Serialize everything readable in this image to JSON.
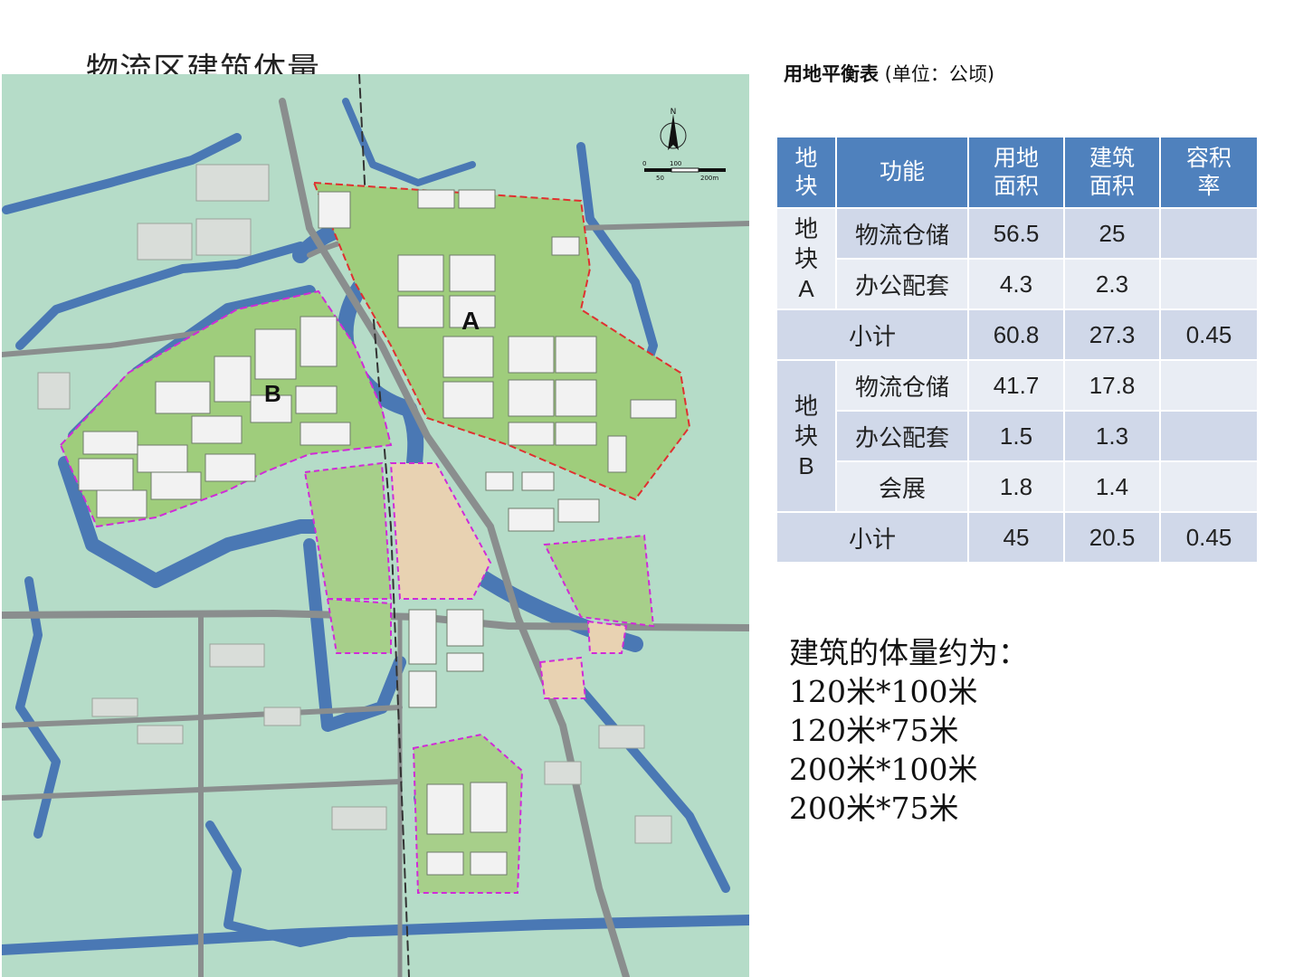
{
  "page_title": "物流区建筑体量",
  "map": {
    "labels": {
      "block_a": "A",
      "block_b": "B"
    },
    "compass": {
      "north": "N",
      "scale": [
        "0",
        "50",
        "100",
        "200m"
      ]
    },
    "colors": {
      "water": "#4a78b4",
      "land": "#b5dcc8",
      "road": "#8a8e8e",
      "green": "#8cc063",
      "boundary_a": "#e03030",
      "boundary_b": "#d02ad8"
    }
  },
  "table": {
    "caption_bold": "用地平衡表",
    "caption_rest": " (单位：公顷)",
    "headers": [
      "地块",
      "功能",
      "用地面积",
      "建筑面积",
      "容积率"
    ],
    "block_a": "地块A",
    "block_b": "地块B",
    "rows": [
      {
        "function": "物流仓储",
        "land": "56.5",
        "building": "25",
        "far": ""
      },
      {
        "function": "办公配套",
        "land": "4.3",
        "building": "2.3",
        "far": ""
      },
      {
        "function": "小计",
        "land": "60.8",
        "building": "27.3",
        "far": "0.45"
      },
      {
        "function": "物流仓储",
        "land": "41.7",
        "building": "17.8",
        "far": ""
      },
      {
        "function": "办公配套",
        "land": "1.5",
        "building": "1.3",
        "far": ""
      },
      {
        "function": "会展",
        "land": "1.8",
        "building": "1.4",
        "far": ""
      },
      {
        "function": "小计",
        "land": "45",
        "building": "20.5",
        "far": "0.45"
      }
    ]
  },
  "note": {
    "heading": "建筑的体量约为：",
    "lines": [
      "120米*100米",
      "120米*75米",
      "200米*100米",
      "200米*75米"
    ]
  }
}
